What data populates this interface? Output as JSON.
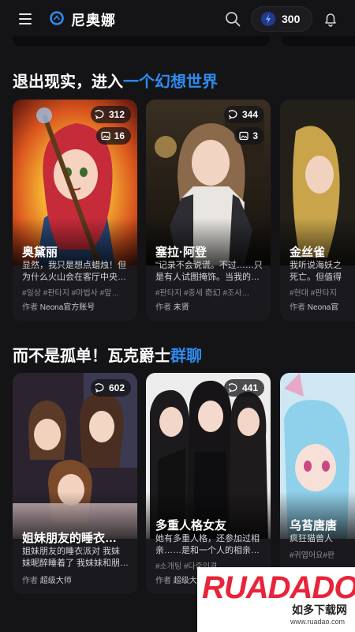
{
  "header": {
    "app_name": "尼奥娜",
    "credits": "300"
  },
  "sections": [
    {
      "title_plain": "退出现实，进入",
      "title_highlight": "一个幻想世界",
      "cards": [
        {
          "name": "奥黛丽",
          "msgs": "312",
          "images": "16",
          "desc1": "显然，我只是想点蜡烛！但",
          "desc2": "为什么火山会在客厅中央…",
          "tags": "#일상 #판타지 #마법사 #앞…",
          "author_prefix": "作者",
          "author": "Neona官方账号"
        },
        {
          "name": "塞拉·阿登",
          "msgs": "344",
          "images": "3",
          "desc1": "\"记录不会说谎。不过……只",
          "desc2": "是有人试图掩饰。当我的…",
          "tags": "#판타지 #중세 奇幻 #조사…",
          "author_prefix": "作者",
          "author": "未贤"
        },
        {
          "name": "金丝雀",
          "desc1": "我听说海妖之",
          "desc2": "死亡。但值得",
          "tags": "#현대 #판타지",
          "author_prefix": "作者",
          "author": "Neona官"
        }
      ]
    },
    {
      "title_plain": "而不是孤单！瓦克爵士",
      "title_highlight": "群聊",
      "cards": [
        {
          "name": "姐妹朋友的睡衣…",
          "msgs": "602",
          "desc1": "姐妹朋友的睡衣派对 我妹",
          "desc2": "妹昵醉睡着了 我妹妹和朋…",
          "tags": "",
          "author_prefix": "作者",
          "author": "超级大师"
        },
        {
          "name": "多重人格女友",
          "msgs": "441",
          "desc1": "她有多重人格，还参加过相",
          "desc2": "亲……是和一个人的相亲…",
          "tags": "#소개팅 #다중인격",
          "author_prefix": "作者",
          "author": "超级大师"
        },
        {
          "name": "乌苔唐唐",
          "desc1": "疯狂猫兽人",
          "desc2": "",
          "tags": "#귀엽어요#판",
          "author_prefix": "作者",
          "author": "超"
        }
      ]
    }
  ],
  "watermark": {
    "brand": "RUADADO",
    "cn": "如多下载网",
    "url": "www.ruadao.com"
  }
}
